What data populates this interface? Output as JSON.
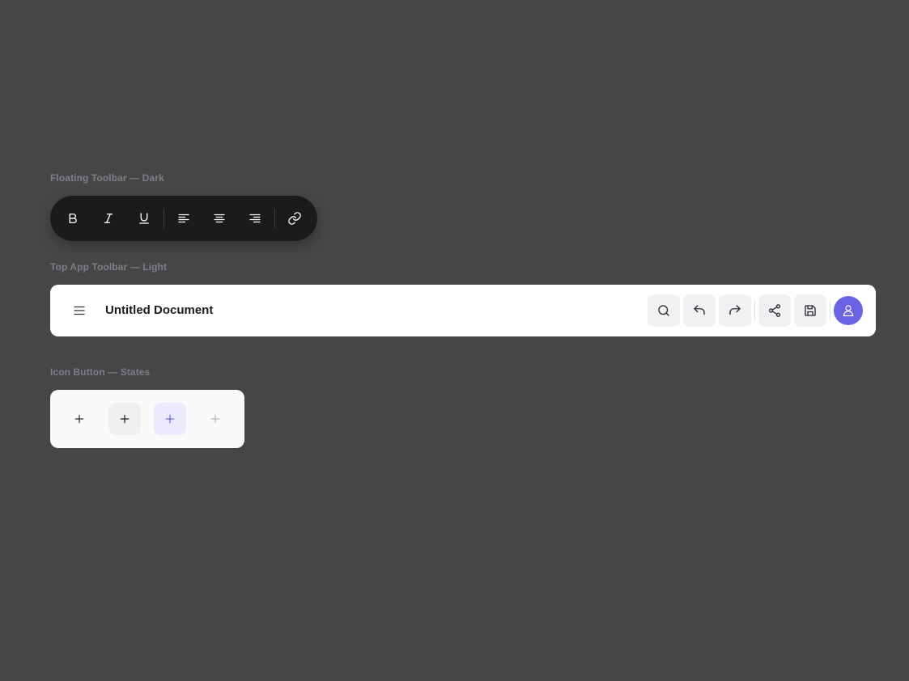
{
  "sections": {
    "floating_label": "Floating Toolbar — Dark",
    "topbar_label": "Top App Toolbar — Light",
    "states_label": "Icon Button — States"
  },
  "floating_toolbar": {
    "buttons": [
      "bold-icon",
      "italic-icon",
      "underline-icon",
      "align-left-icon",
      "align-center-icon",
      "align-right-icon",
      "link-icon"
    ],
    "icon_color": "#ffffff",
    "background": "#1b1b1e"
  },
  "app_toolbar": {
    "title": "Untitled Document",
    "actions": [
      "search-icon",
      "undo-icon",
      "redo-icon",
      "share-icon",
      "save-icon"
    ],
    "avatar_color": "#6b63e6"
  },
  "icon_button_states": {
    "states": [
      "default",
      "hover",
      "active",
      "disabled"
    ],
    "icon": "plus-icon",
    "active_color": "#6b63e6",
    "active_background": "#ecebfd",
    "hover_background": "#f0f0f2",
    "disabled_color": "#b5b5bb"
  }
}
